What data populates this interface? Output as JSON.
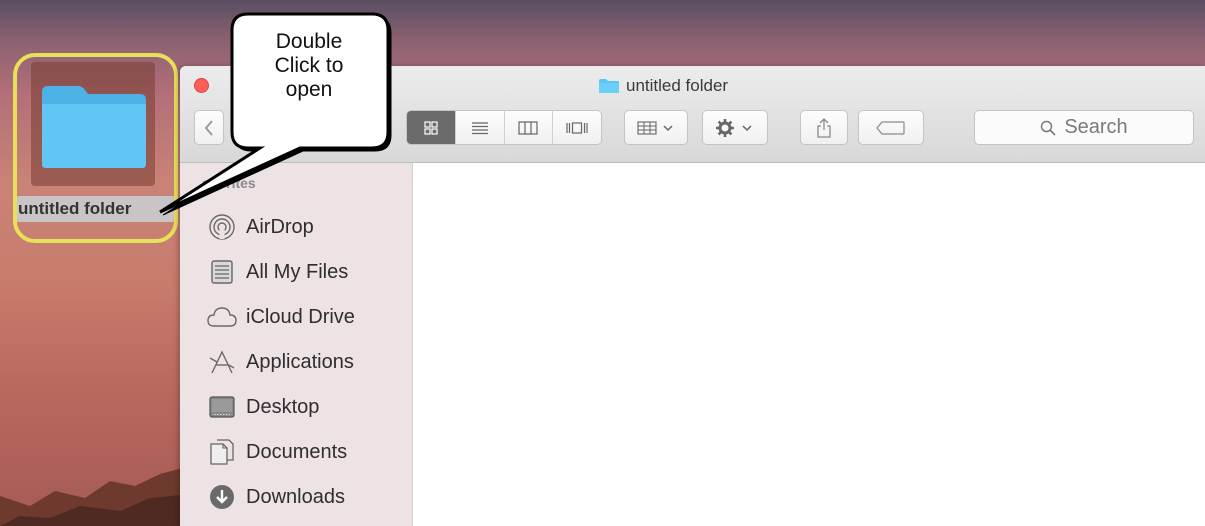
{
  "desktop": {
    "folder_label": "untitled folder"
  },
  "callout": {
    "line1": "Double",
    "line2": "Click to",
    "line3": "open"
  },
  "window": {
    "title": "untitled folder",
    "search_placeholder": "Search"
  },
  "sidebar": {
    "heading": "avorites",
    "items": [
      {
        "label": "AirDrop",
        "icon": "airdrop-icon"
      },
      {
        "label": "All My Files",
        "icon": "all-files-icon"
      },
      {
        "label": "iCloud Drive",
        "icon": "cloud-icon"
      },
      {
        "label": "Applications",
        "icon": "applications-icon"
      },
      {
        "label": "Desktop",
        "icon": "desktop-icon"
      },
      {
        "label": "Documents",
        "icon": "documents-icon"
      },
      {
        "label": "Downloads",
        "icon": "downloads-icon"
      }
    ]
  },
  "colors": {
    "folder_blue": "#5ec4f4",
    "highlight_ring": "#e7e05a",
    "close_red": "#fc5f57"
  }
}
